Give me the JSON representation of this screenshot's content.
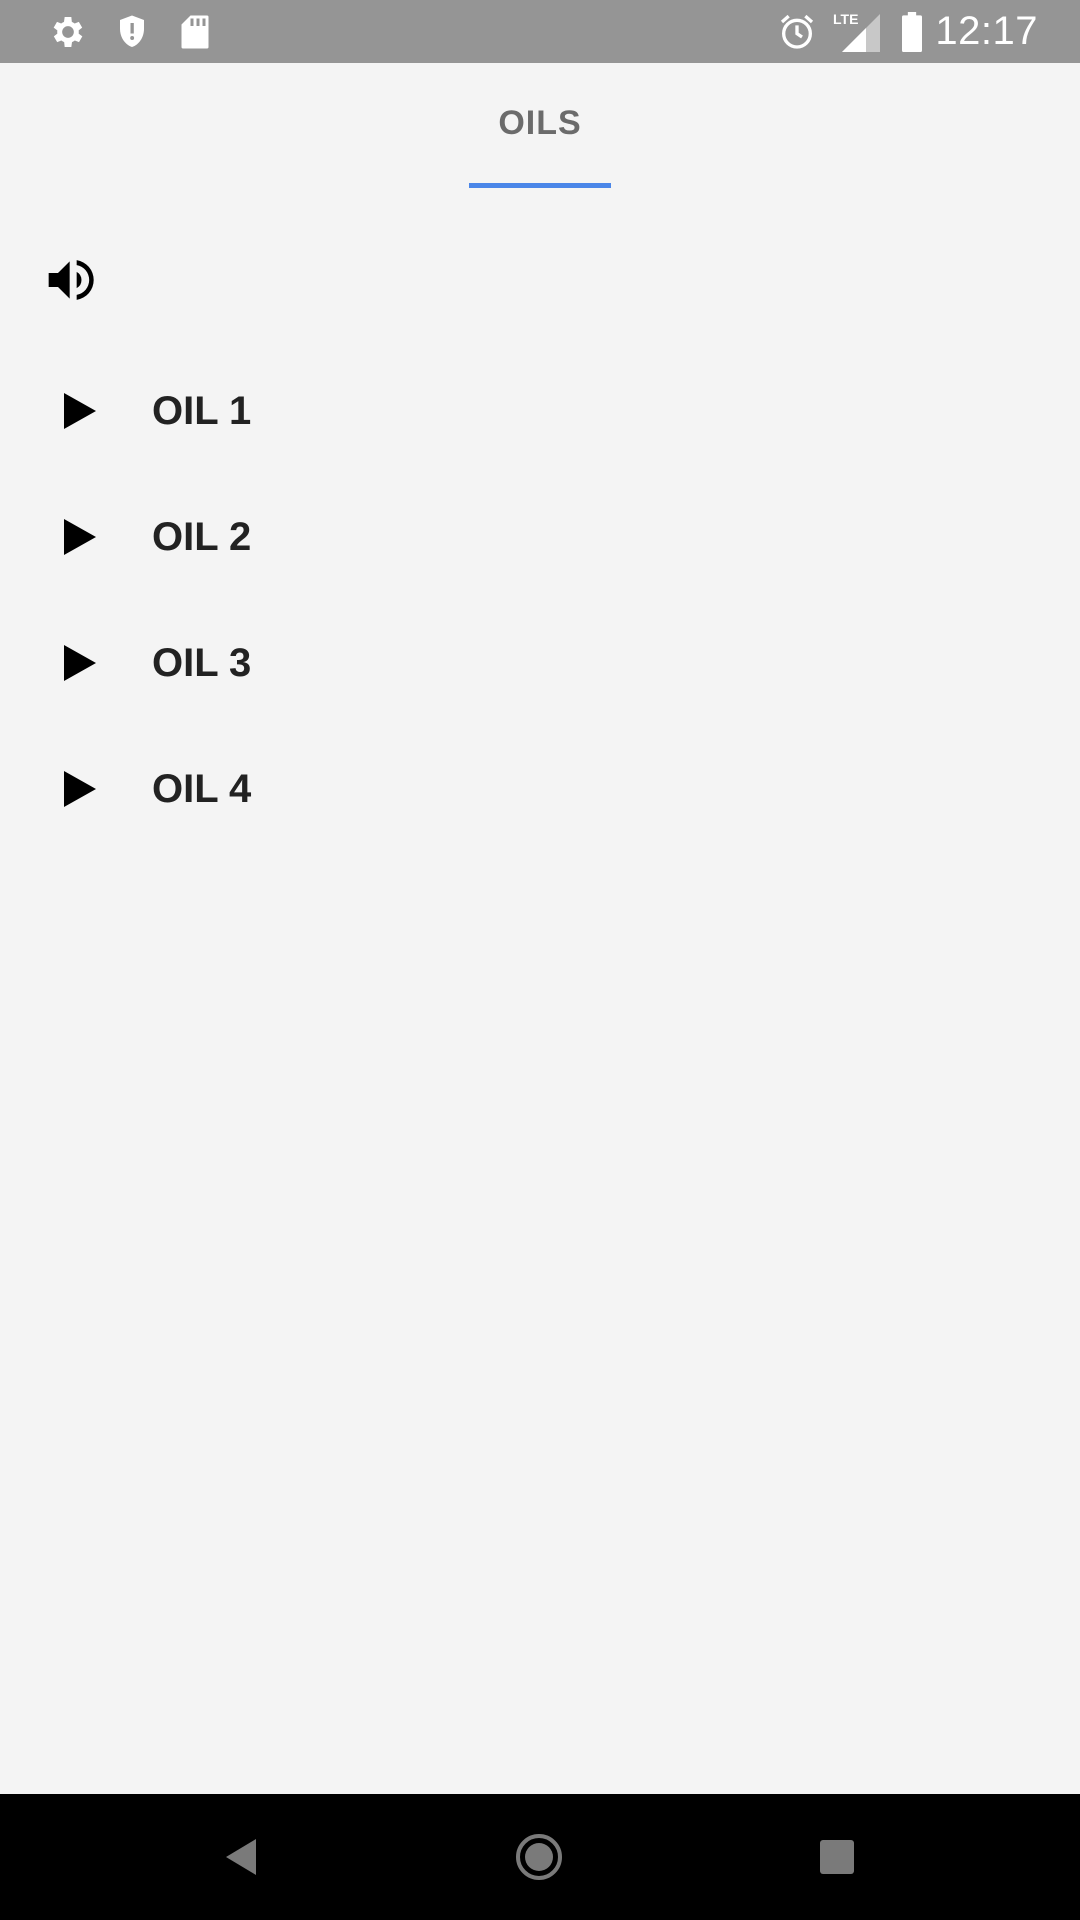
{
  "status_bar": {
    "time": "12:17",
    "network_label": "LTE",
    "left_icons": [
      "gear-icon",
      "shield-icon",
      "sd-card-icon"
    ],
    "right_icons": [
      "alarm-icon",
      "signal-icon",
      "battery-icon"
    ]
  },
  "tabs": [
    {
      "label": "OILS",
      "selected": true
    }
  ],
  "accent_color": "#4a86e8",
  "toolbar": {
    "volume_icon": "volume-icon"
  },
  "oils": [
    {
      "label": "OIL 1",
      "icon": "play-icon"
    },
    {
      "label": "OIL 2",
      "icon": "play-icon"
    },
    {
      "label": "OIL 3",
      "icon": "play-icon"
    },
    {
      "label": "OIL 4",
      "icon": "play-icon"
    }
  ],
  "nav_bar": {
    "buttons": [
      "back-icon",
      "home-icon",
      "recents-icon"
    ]
  }
}
